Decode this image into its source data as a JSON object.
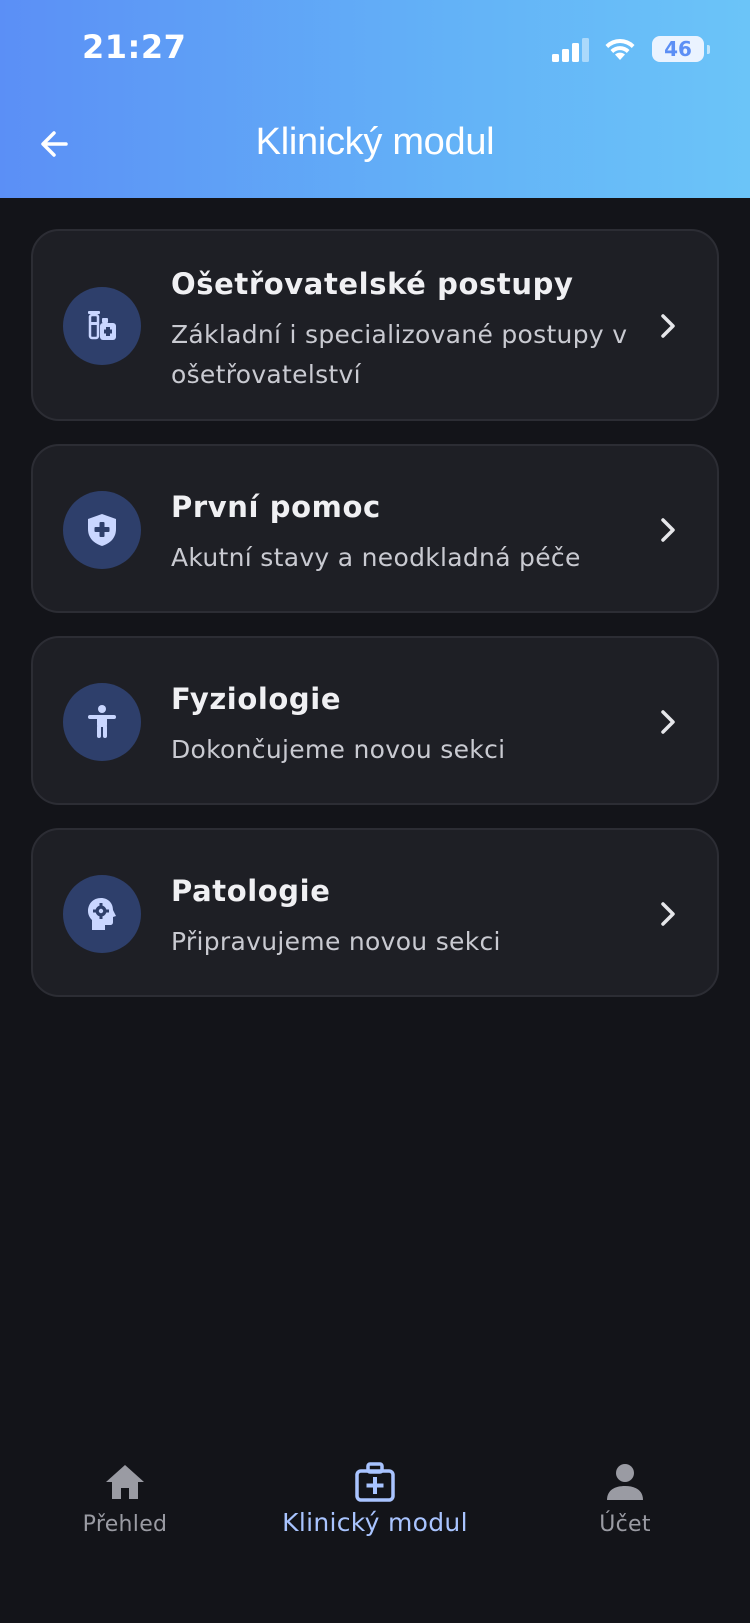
{
  "status_bar": {
    "time": "21:27",
    "battery": "46"
  },
  "header": {
    "title": "Klinický modul"
  },
  "cards": [
    {
      "title": "Ošetřovatelské postupy",
      "subtitle": "Základní i specializované postupy v ošetřovatelství",
      "icon": "medication-vial-icon"
    },
    {
      "title": "První pomoc",
      "subtitle": "Akutní stavy a neodkladná péče",
      "icon": "shield-plus-icon"
    },
    {
      "title": "Fyziologie",
      "subtitle": "Dokončujeme novou sekci",
      "icon": "human-body-icon"
    },
    {
      "title": "Patologie",
      "subtitle": "Připravujeme novou sekci",
      "icon": "head-gear-icon"
    }
  ],
  "bottom_nav": {
    "items": [
      {
        "label": "Přehled",
        "icon": "home-icon"
      },
      {
        "label": "Klinický modul",
        "icon": "medical-kit-icon",
        "active": true
      },
      {
        "label": "Účet",
        "icon": "person-icon"
      }
    ]
  },
  "colors": {
    "accent": "#a9c4ff",
    "header_start": "#5b8ff6",
    "header_end": "#6bc4f8",
    "background": "#131419",
    "card": "#1e1f25"
  }
}
